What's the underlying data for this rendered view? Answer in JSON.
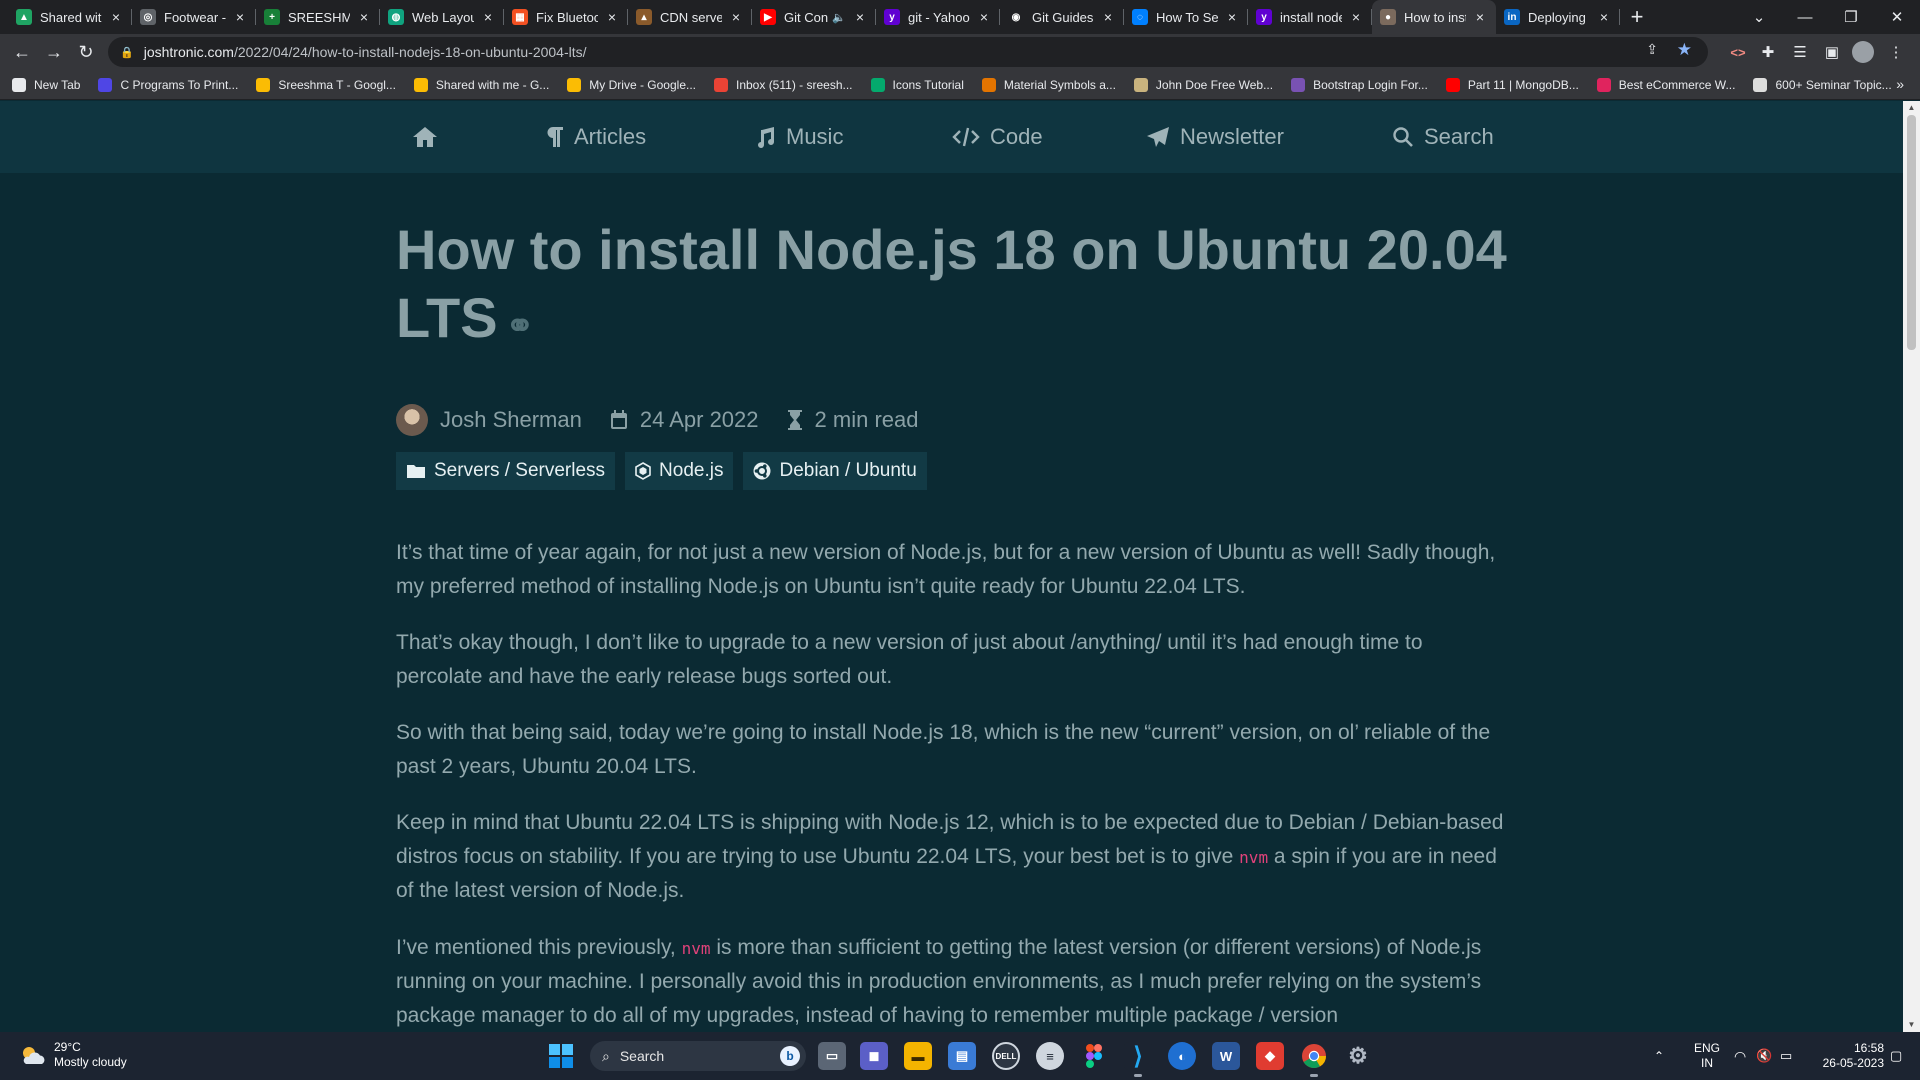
{
  "browser": {
    "tabs": [
      {
        "label": "Shared with",
        "fav_color": "#1fa463",
        "fav_glyph": "▲"
      },
      {
        "label": "Footwear -",
        "fav_color": "#5f6368",
        "fav_glyph": "◎"
      },
      {
        "label": "SREESHMA",
        "fav_color": "#188038",
        "fav_glyph": "+"
      },
      {
        "label": "Web Layout",
        "fav_color": "#10a37f",
        "fav_glyph": "◍"
      },
      {
        "label": "Fix Bluetoo",
        "fav_color": "#f25022",
        "fav_glyph": "▦"
      },
      {
        "label": "CDN server",
        "fav_color": "#8a5a2b",
        "fav_glyph": "▴"
      },
      {
        "label": "Git Con",
        "fav_color": "#ff0000",
        "fav_glyph": "▶",
        "audio": "🔈"
      },
      {
        "label": "git - Yahoo",
        "fav_color": "#6001d2",
        "fav_glyph": "y"
      },
      {
        "label": "Git Guides",
        "fav_color": "#202124",
        "fav_glyph": "◉"
      },
      {
        "label": "How To Set",
        "fav_color": "#0080ff",
        "fav_glyph": "◌"
      },
      {
        "label": "install node",
        "fav_color": "#6001d2",
        "fav_glyph": "y"
      },
      {
        "label": "How to inst",
        "fav_color": "#7b6a5d",
        "fav_glyph": "●",
        "active": true
      },
      {
        "label": "Deploying",
        "fav_color": "#0a66c2",
        "fav_glyph": "in"
      }
    ],
    "close_glyph": "×",
    "new_tab_glyph": "+",
    "url_host": "joshtronic.com",
    "url_path": "/2022/04/24/how-to-install-nodejs-18-on-ubuntu-2004-lts/",
    "bookmarks": [
      {
        "label": "New Tab",
        "color": "#e8eaed"
      },
      {
        "label": "C Programs To Print...",
        "color": "#4f46e5"
      },
      {
        "label": "Sreeshma T - Googl...",
        "color": "#fbbc04"
      },
      {
        "label": "Shared with me - G...",
        "color": "#fbbc04"
      },
      {
        "label": "My Drive - Google...",
        "color": "#fbbc04"
      },
      {
        "label": "Inbox (511) - sreesh...",
        "color": "#ea4335"
      },
      {
        "label": "Icons Tutorial",
        "color": "#04aa6d"
      },
      {
        "label": "Material Symbols a...",
        "color": "#e37400"
      },
      {
        "label": "John Doe Free Web...",
        "color": "#c9b37e"
      },
      {
        "label": "Bootstrap Login For...",
        "color": "#7952b3"
      },
      {
        "label": "Part 11 | MongoDB...",
        "color": "#ff0000"
      },
      {
        "label": "Best eCommerce W...",
        "color": "#e0245e"
      },
      {
        "label": "600+ Seminar Topic...",
        "color": "#dddddd"
      }
    ],
    "bookmarks_more": "»"
  },
  "site_nav": {
    "items": [
      {
        "label": "",
        "icon": "home-icon"
      },
      {
        "label": "Articles",
        "icon": "pilcrow-icon"
      },
      {
        "label": "Music",
        "icon": "music-icon"
      },
      {
        "label": "Code",
        "icon": "code-icon"
      },
      {
        "label": "Newsletter",
        "icon": "paper-plane-icon"
      },
      {
        "label": "Search",
        "icon": "search-icon"
      }
    ]
  },
  "article": {
    "title": "How to install Node.js 18 on Ubuntu 20.04 LTS",
    "author": "Josh Sherman",
    "date": "24 Apr 2022",
    "read_time": "2 min read",
    "tags": [
      "Servers / Serverless",
      "Node.js",
      "Debian / Ubuntu"
    ],
    "p1": "It’s that time of year again, for not just a new version of Node.js, but for a new version of Ubuntu as well! Sadly though, my preferred method of installing Node.js on Ubuntu isn’t quite ready for Ubuntu 22.04 LTS.",
    "p2": "That’s okay though, I don’t like to upgrade to a new version of just about /anything/ until it’s had enough time to percolate and have the early release bugs sorted out.",
    "p3": "So with that being said, today we’re going to install Node.js 18, which is the new “current” version, on ol’ reliable of the past 2 years, Ubuntu 20.04 LTS.",
    "p4_a": "Keep in mind that Ubuntu 22.04 LTS is shipping with Node.js 12, which is to be expected due to Debian / Debian-based distros focus on stability. If you are trying to use Ubuntu 22.04 LTS, your best bet is to give ",
    "p4_code": "nvm",
    "p4_b": " a spin if you are in need of the latest version of Node.js.",
    "p5_a": "I’ve mentioned this previously, ",
    "p5_code": "nvm",
    "p5_b": " is more than sufficient to getting the latest version (or different versions) of Node.js running on your machine. I personally avoid this in production environments, as I much prefer relying on the system’s package manager to do all of my upgrades, instead of having to remember multiple package / version"
  },
  "taskbar": {
    "temp": "29°C",
    "condition": "Mostly cloudy",
    "search_label": "Search",
    "lang_top": "ENG",
    "lang_bottom": "IN",
    "time": "16:58",
    "date": "26-05-2023"
  }
}
